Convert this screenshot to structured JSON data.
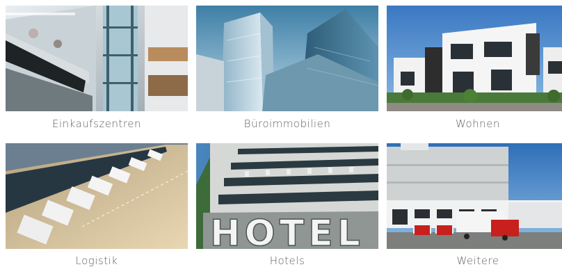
{
  "tiles": [
    {
      "label": "Einkaufszentren"
    },
    {
      "label": "Büroimmobilien"
    },
    {
      "label": "Wohnen"
    },
    {
      "label": "Logistik"
    },
    {
      "label": "Hotels"
    },
    {
      "label": "Weitere"
    }
  ],
  "hotel_sign": "HOTEL"
}
